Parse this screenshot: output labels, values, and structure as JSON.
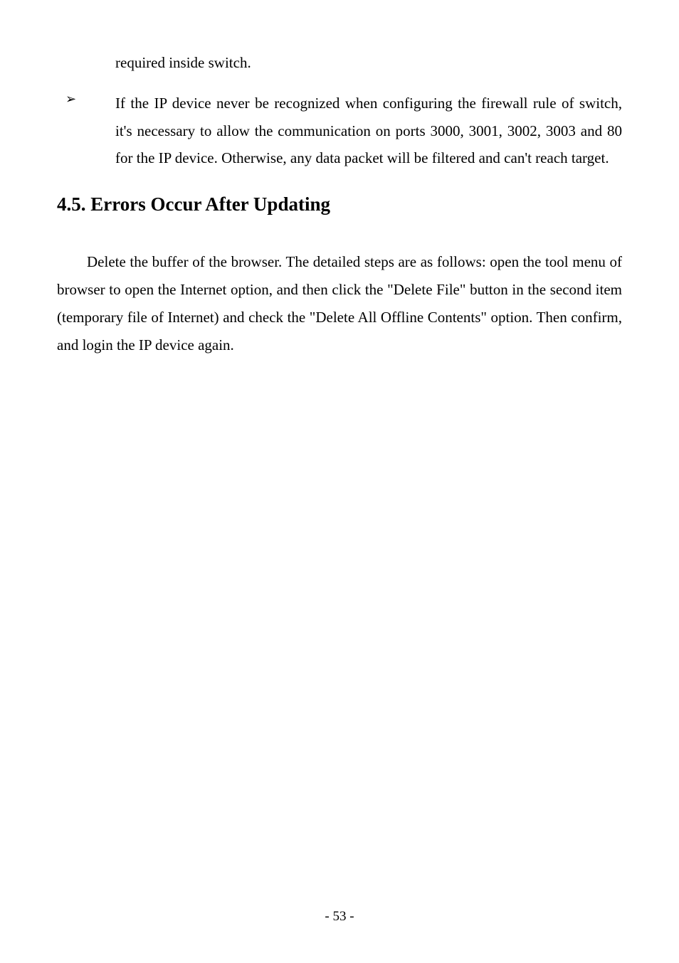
{
  "continuation": "required inside switch.",
  "bullet": {
    "marker": "➢",
    "text": "If the IP device never be recognized when configuring the firewall rule of switch, it's necessary to allow the communication on ports 3000, 3001, 3002, 3003 and 80 for the IP device. Otherwise, any data packet will be filtered and can't reach target."
  },
  "heading": "4.5. Errors Occur After Updating",
  "paragraph": "Delete the buffer of the browser. The detailed steps are as follows: open the tool menu of browser to open the Internet option, and then click the \"Delete File\" button in the second item (temporary file of Internet) and check the \"Delete All Offline Contents\" option. Then confirm, and login the IP device again.",
  "pageNumber": "- 53 -"
}
